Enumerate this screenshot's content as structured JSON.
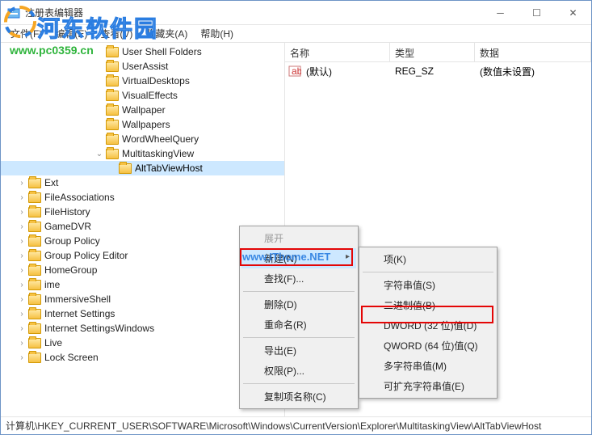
{
  "window": {
    "title": "注册表编辑器"
  },
  "menubar": [
    {
      "label": "文件(F)"
    },
    {
      "label": "编辑(E)"
    },
    {
      "label": "查看(V)"
    },
    {
      "label": "收藏夹(A)"
    },
    {
      "label": "帮助(H)"
    }
  ],
  "columns": {
    "name": "名称",
    "type": "类型",
    "data": "数据"
  },
  "listRows": [
    {
      "name": "(默认)",
      "type": "REG_SZ",
      "data": "(数值未设置)"
    }
  ],
  "tree": [
    {
      "indent": 2,
      "exp": "none",
      "label": "User Shell Folders"
    },
    {
      "indent": 2,
      "exp": "none",
      "label": "UserAssist"
    },
    {
      "indent": 2,
      "exp": "none",
      "label": "VirtualDesktops"
    },
    {
      "indent": 2,
      "exp": "none",
      "label": "VisualEffects"
    },
    {
      "indent": 2,
      "exp": "none",
      "label": "Wallpaper"
    },
    {
      "indent": 2,
      "exp": "none",
      "label": "Wallpapers"
    },
    {
      "indent": 2,
      "exp": "none",
      "label": "WordWheelQuery"
    },
    {
      "indent": 2,
      "exp": "open",
      "label": "MultitaskingView"
    },
    {
      "indent": 3,
      "exp": "none",
      "label": "AltTabViewHost",
      "selected": true
    },
    {
      "indent": 1,
      "exp": "closed",
      "label": "Ext"
    },
    {
      "indent": 1,
      "exp": "closed",
      "label": "FileAssociations"
    },
    {
      "indent": 1,
      "exp": "closed",
      "label": "FileHistory"
    },
    {
      "indent": 1,
      "exp": "closed",
      "label": "GameDVR"
    },
    {
      "indent": 1,
      "exp": "closed",
      "label": "Group Policy"
    },
    {
      "indent": 1,
      "exp": "closed",
      "label": "Group Policy Editor"
    },
    {
      "indent": 1,
      "exp": "closed",
      "label": "HomeGroup"
    },
    {
      "indent": 1,
      "exp": "closed",
      "label": "ime"
    },
    {
      "indent": 1,
      "exp": "closed",
      "label": "ImmersiveShell"
    },
    {
      "indent": 1,
      "exp": "closed",
      "label": "Internet Settings"
    },
    {
      "indent": 1,
      "exp": "closed",
      "label": "Internet SettingsWindows"
    },
    {
      "indent": 1,
      "exp": "closed",
      "label": "Live"
    },
    {
      "indent": 1,
      "exp": "closed",
      "label": "Lock Screen"
    }
  ],
  "ctx1": {
    "expand": "展开",
    "new": "新建(N)",
    "find": "查找(F)...",
    "delete": "删除(D)",
    "rename": "重命名(R)",
    "export": "导出(E)",
    "perm": "权限(P)...",
    "copykey": "复制项名称(C)"
  },
  "ctx2": {
    "key": "项(K)",
    "string": "字符串值(S)",
    "binary": "二进制值(B)",
    "dword": "DWORD (32 位)值(D)",
    "qword": "QWORD (64 位)值(Q)",
    "multi": "多字符串值(M)",
    "expand": "可扩充字符串值(E)"
  },
  "statusbar": "计算机\\HKEY_CURRENT_USER\\SOFTWARE\\Microsoft\\Windows\\CurrentVersion\\Explorer\\MultitaskingView\\AltTabViewHost",
  "watermark": {
    "url": "www.pc0359.cn",
    "brand": "河东软件园",
    "mid": "www.IThome.NET"
  }
}
